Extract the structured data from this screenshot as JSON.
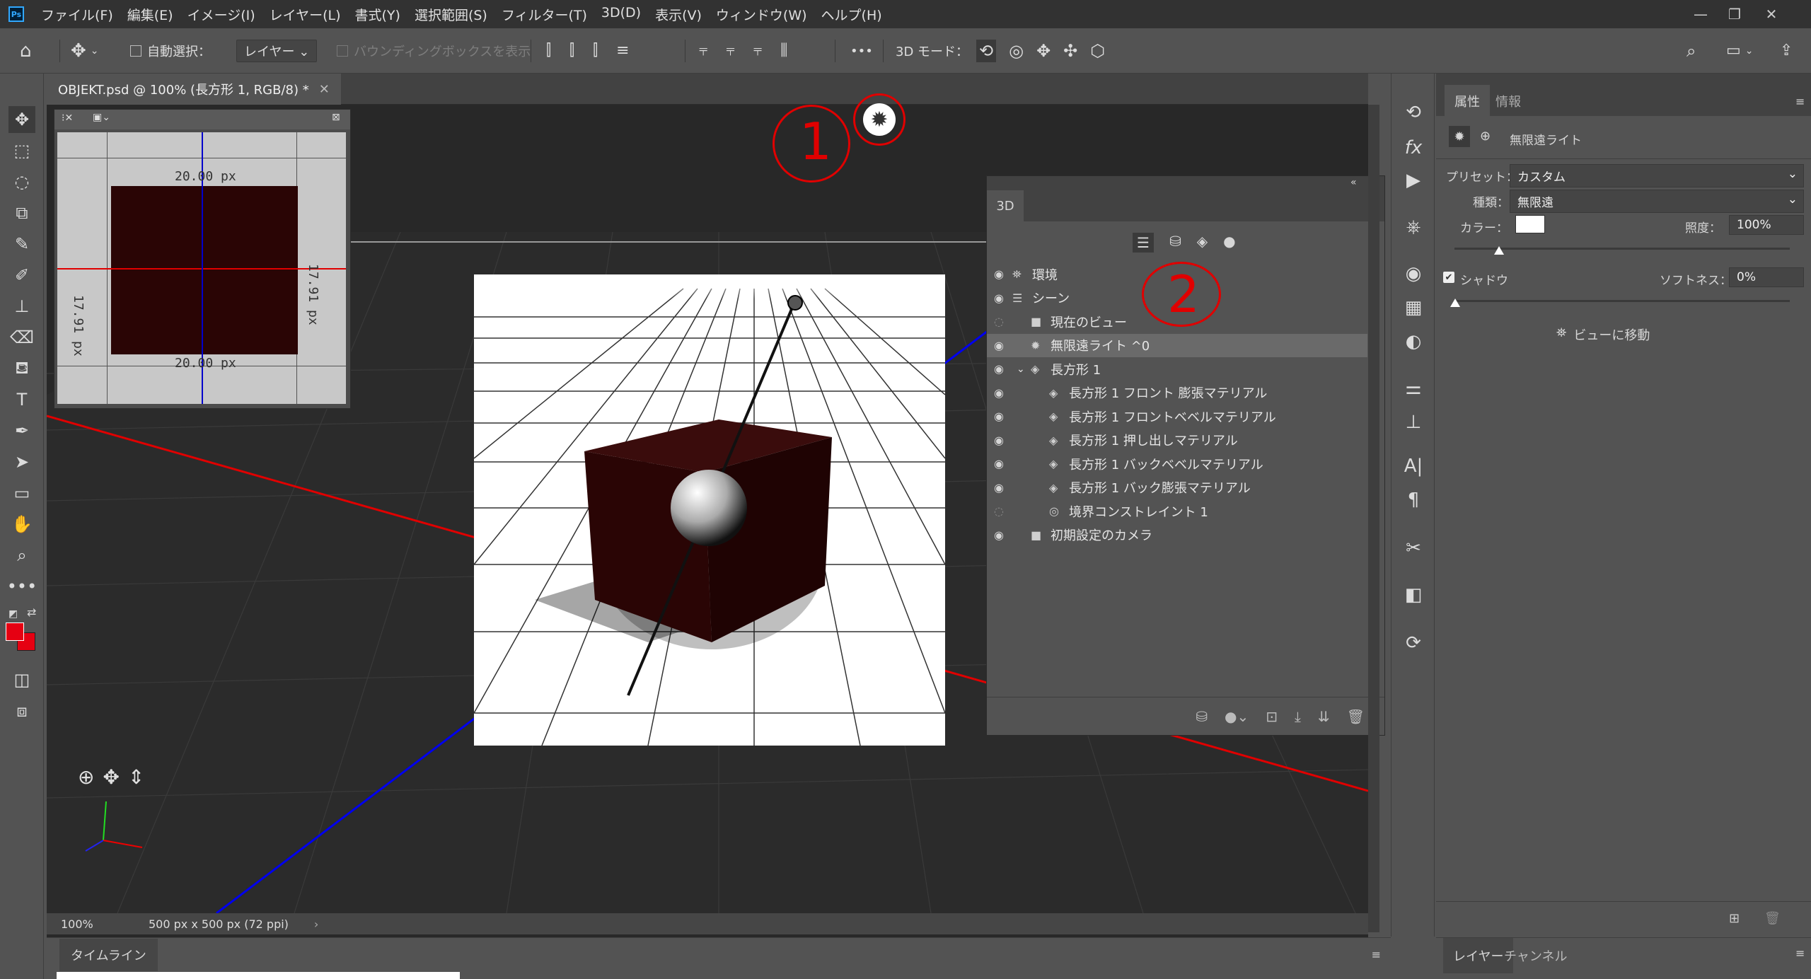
{
  "menu": {
    "logo": "Ps",
    "items": [
      "ファイル(F)",
      "編集(E)",
      "イメージ(I)",
      "レイヤー(L)",
      "書式(Y)",
      "選択範囲(S)",
      "フィルター(T)",
      "3D(D)",
      "表示(V)",
      "ウィンドウ(W)",
      "ヘルプ(H)"
    ]
  },
  "options": {
    "auto_select_label": "自動選択：",
    "auto_select_value": "レイヤー",
    "bbox_label": "バウンディングボックスを表示",
    "more": "•••",
    "mode_3d_label": "3D モード："
  },
  "document": {
    "tab_title": "OBJEKT.psd @ 100% (長方形 1, RGB/8) *",
    "zoom": "100%",
    "size_info": "500 px x 500 px (72 ppi)"
  },
  "mini_view": {
    "top_label": "20.00 px",
    "bottom_label": "20.00 px",
    "side_label": "17.91 px"
  },
  "annotations": {
    "one": "1",
    "two": "2"
  },
  "panel3d": {
    "tab": "3D",
    "rows": [
      {
        "label": "環境",
        "indent": 0,
        "eye": true,
        "icon": "env"
      },
      {
        "label": "シーン",
        "indent": 0,
        "eye": true,
        "icon": "scene"
      },
      {
        "label": "現在のビュー",
        "indent": 1,
        "eye": false,
        "icon": "camera"
      },
      {
        "label": "無限遠ライト ^0",
        "indent": 1,
        "eye": true,
        "icon": "light",
        "selected": true
      },
      {
        "label": "長方形 1",
        "indent": 1,
        "eye": true,
        "icon": "mesh",
        "expanded": true
      },
      {
        "label": "長方形 1 フロント 膨張マテリアル",
        "indent": 2,
        "eye": true,
        "icon": "material"
      },
      {
        "label": "長方形 1 フロントベベルマテリアル",
        "indent": 2,
        "eye": true,
        "icon": "material"
      },
      {
        "label": "長方形 1 押し出しマテリアル",
        "indent": 2,
        "eye": true,
        "icon": "material"
      },
      {
        "label": "長方形 1 バックベベルマテリアル",
        "indent": 2,
        "eye": true,
        "icon": "material"
      },
      {
        "label": "長方形 1 バック膨張マテリアル",
        "indent": 2,
        "eye": true,
        "icon": "material"
      },
      {
        "label": "境界コンストレイント 1",
        "indent": 2,
        "eye": false,
        "icon": "constraint"
      },
      {
        "label": "初期設定のカメラ",
        "indent": 1,
        "eye": true,
        "icon": "camera"
      }
    ]
  },
  "properties": {
    "tab_active": "属性",
    "tab_other": "情報",
    "header": "無限遠ライト",
    "preset_label": "プリセット：",
    "preset_value": "カスタム",
    "type_label": "種類：",
    "type_value": "無限遠",
    "color_label": "カラー：",
    "color_value": "#ffffff",
    "intensity_label": "照度：",
    "intensity_value": "100%",
    "shadow_label": "シャドウ",
    "softness_label": "ソフトネス：",
    "softness_value": "0%",
    "move_to_view": "ビューに移動"
  },
  "bottom": {
    "timeline": "タイムライン",
    "layers": "レイヤー",
    "channels": "チャンネル"
  },
  "colors": {
    "foreground": "#e60012",
    "background": "#e60012",
    "accent_blue": "#31a8ff",
    "annotation_red": "#e00000"
  }
}
